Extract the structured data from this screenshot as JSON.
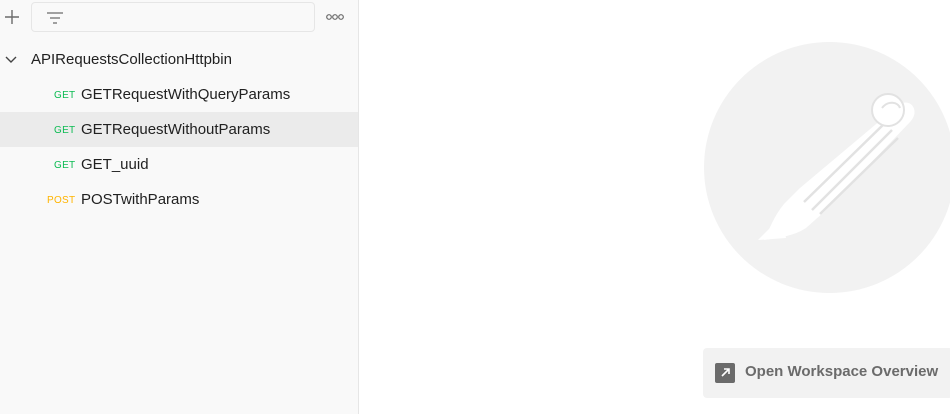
{
  "sidebar": {
    "toolbar": {
      "add_icon": "plus-icon",
      "filter_icon": "filter-icon",
      "filter_placeholder": "",
      "more_icon": "more-options-icon"
    },
    "collection": {
      "name": "APIRequestsCollectionHttpbin",
      "expanded": true,
      "requests": [
        {
          "method": "GET",
          "name": "GETRequestWithQueryParams",
          "selected": false
        },
        {
          "method": "GET",
          "name": "GETRequestWithoutParams",
          "selected": true
        },
        {
          "method": "GET",
          "name": "GET_uuid",
          "selected": false
        },
        {
          "method": "POST",
          "name": "POSTwithParams",
          "selected": false
        }
      ]
    }
  },
  "main": {
    "logo": "postman-logo",
    "overview_button_label": "Open Workspace Overview",
    "overview_icon": "external-link-icon"
  },
  "colors": {
    "get": "#0cbb52",
    "post": "#ffb400",
    "selected_row": "#ebebeb",
    "sidebar_bg": "#f9f9f9",
    "logo_bg": "#f2f2f2"
  }
}
